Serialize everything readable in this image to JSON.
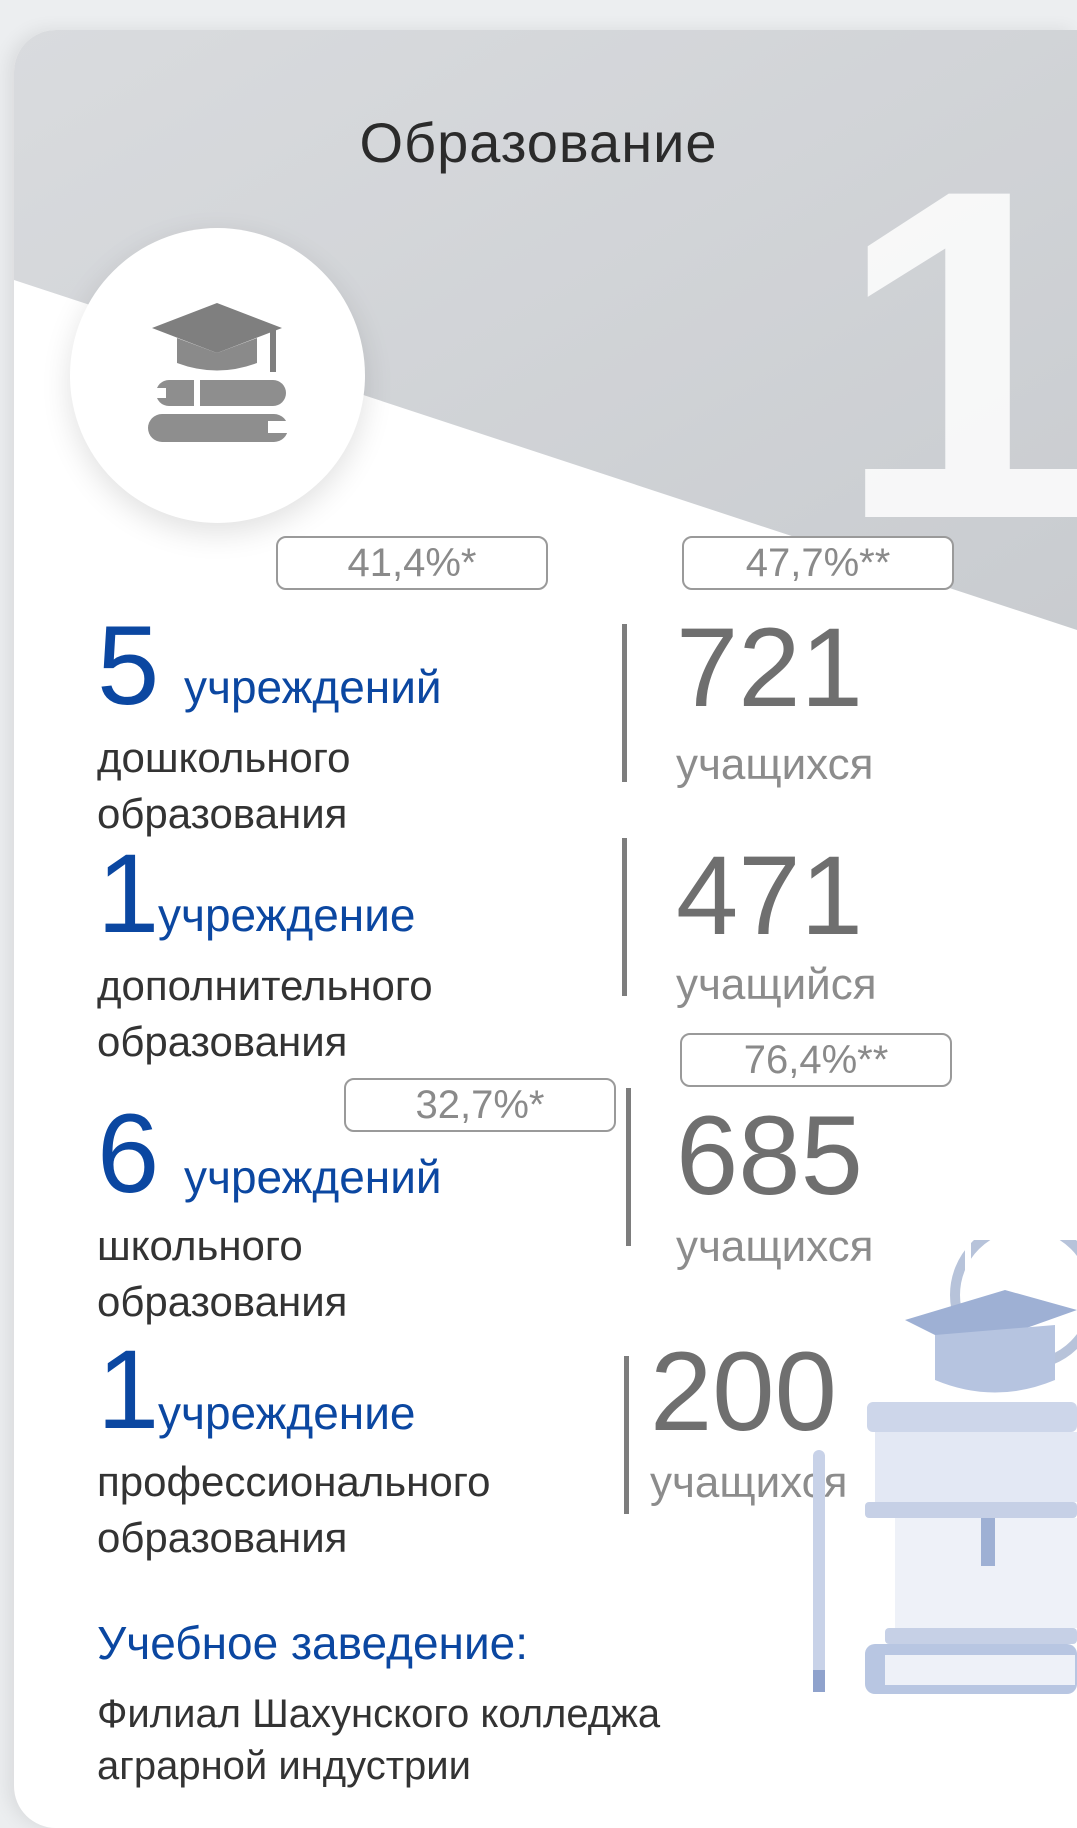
{
  "card": {
    "title": "Образование",
    "section_number": "1",
    "icon": "graduation-cap-books-icon"
  },
  "rows": [
    {
      "count": "5",
      "unit": "учреждений",
      "desc_line1": "дошкольного",
      "desc_line2": "образования",
      "count_badge": "41,4%*",
      "stat_badge": "47,7%**",
      "stat_value": "721",
      "stat_label": "учащихся"
    },
    {
      "count": "1",
      "unit": "учреждение",
      "desc_line1": "дополнительного",
      "desc_line2": "образования",
      "stat_value": "471",
      "stat_label": "учащийся"
    },
    {
      "count": "6",
      "unit": "учреждений",
      "desc_line1": "школьного",
      "desc_line2": "образования",
      "count_badge": "32,7%*",
      "stat_badge": "76,4%**",
      "stat_value": "685",
      "stat_label": "учащихся"
    },
    {
      "count": "1",
      "unit": "учреждение",
      "desc_line1": "профессионального",
      "desc_line2": "образования",
      "stat_value": "200",
      "stat_label": "учащихся"
    }
  ],
  "institution": {
    "heading": "Учебное заведение:",
    "name_line1": "Филиал Шахунского колледжа",
    "name_line2": "аграрной индустрии"
  },
  "colors": {
    "accent_blue": "#0b47a1",
    "stat_gray": "#6f6f6f",
    "text_dark": "#333333"
  }
}
